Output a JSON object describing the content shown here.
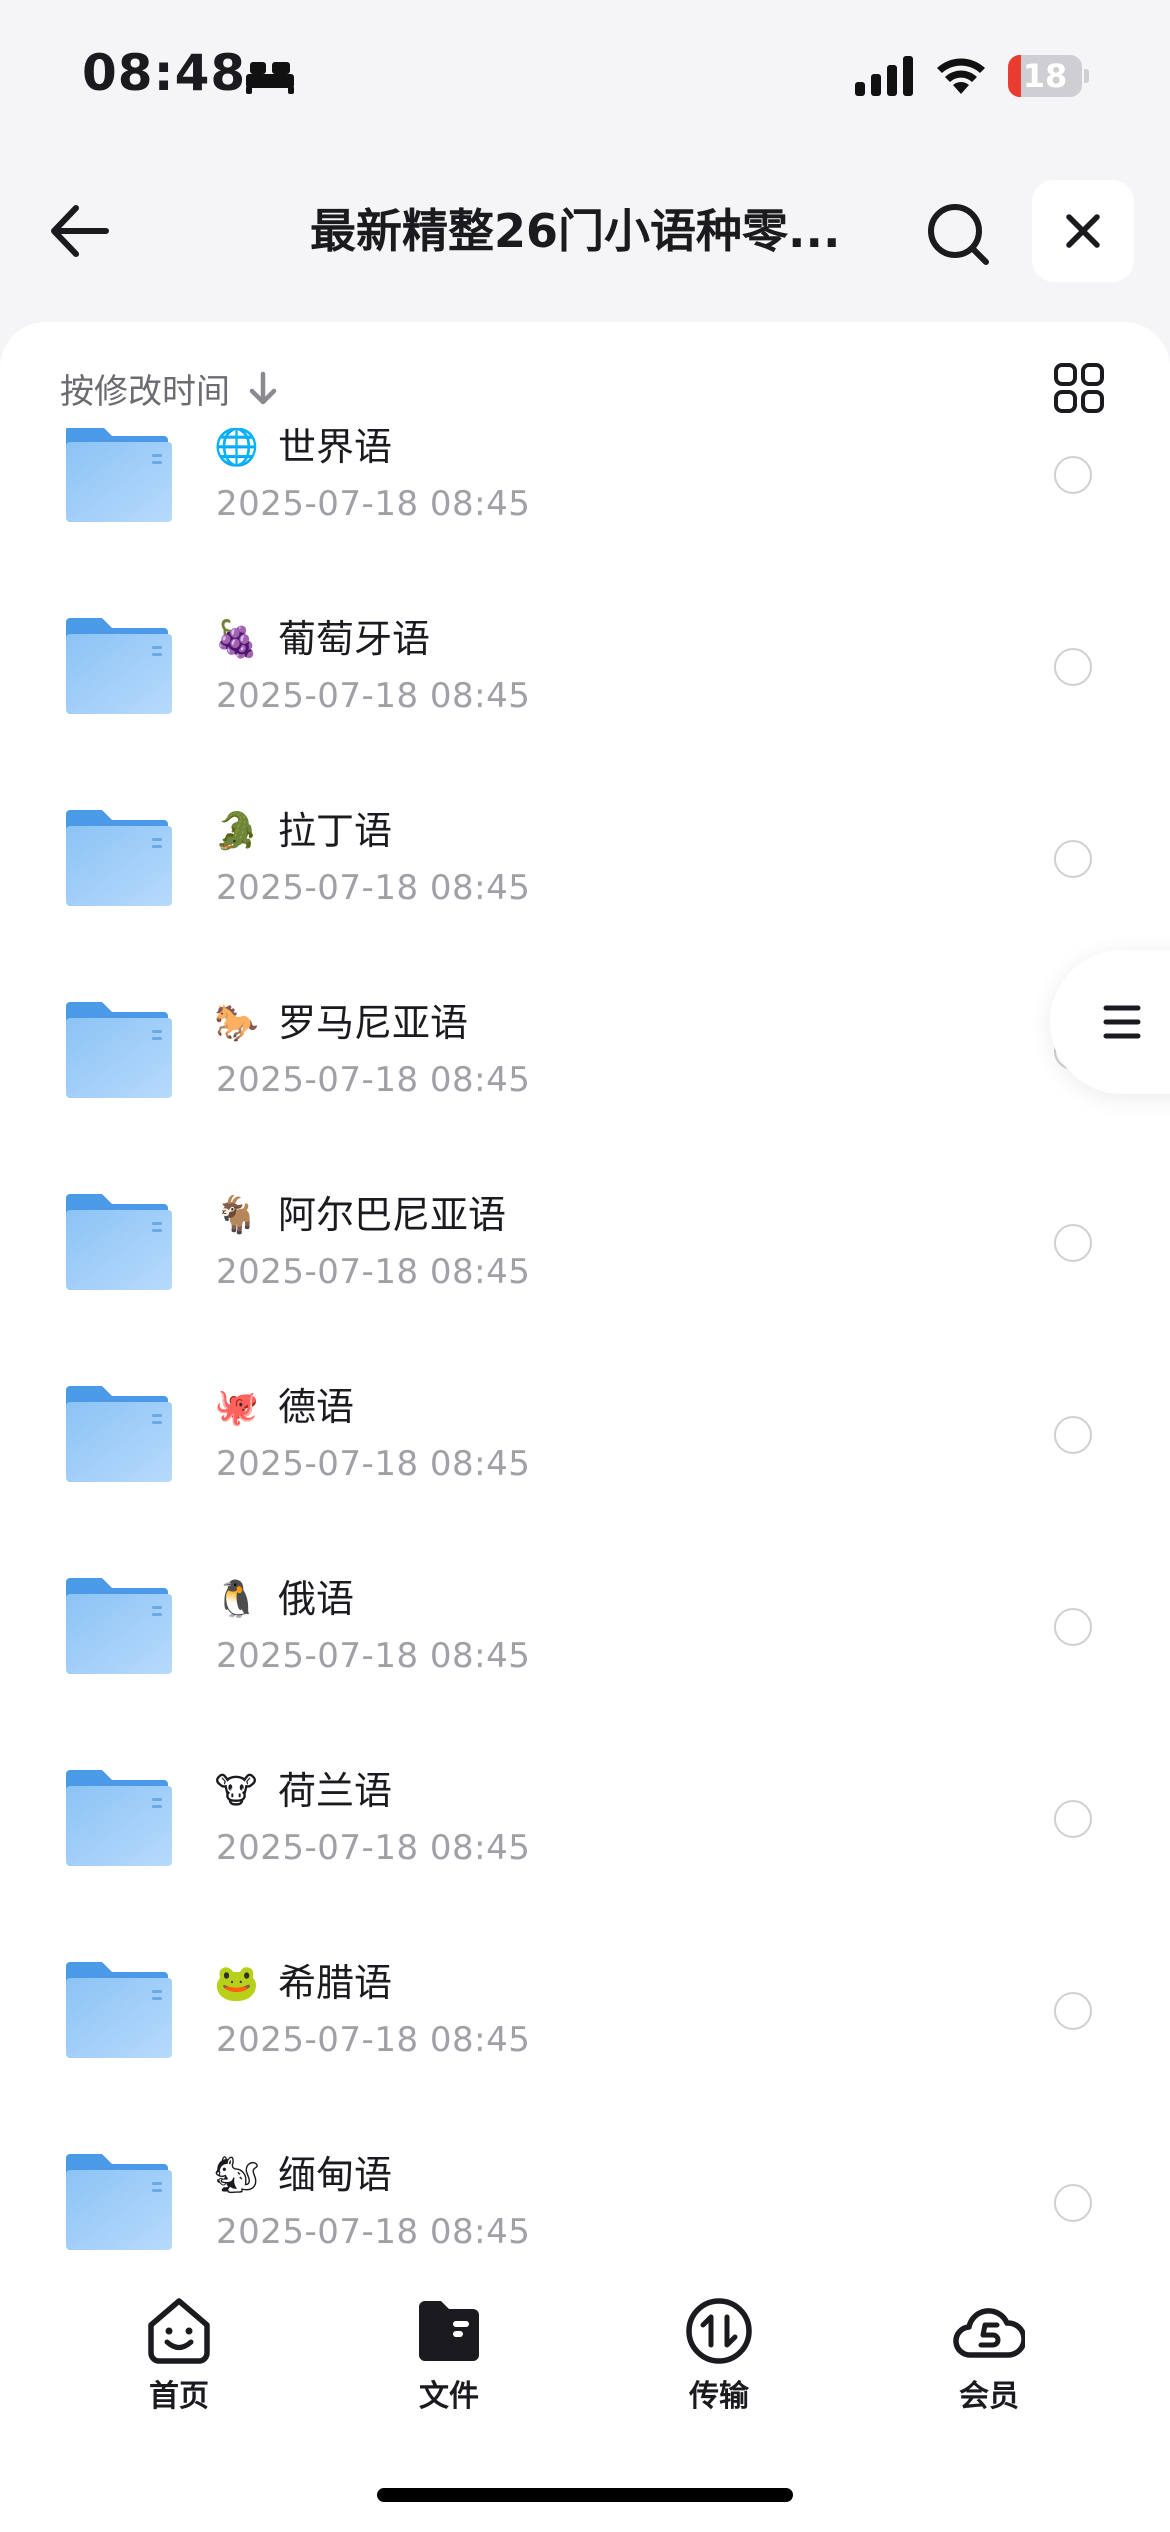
{
  "status_bar": {
    "time": "08:48",
    "battery_level": "18",
    "battery_fraction": 0.18
  },
  "header": {
    "title": "最新精整26门小语种零..."
  },
  "sort": {
    "label": "按修改时间"
  },
  "files": [
    {
      "emoji": "🌐",
      "name": "世界语",
      "date": "2025-07-18 08:45"
    },
    {
      "emoji": "🍇",
      "name": "葡萄牙语",
      "date": "2025-07-18 08:45"
    },
    {
      "emoji": "🐊",
      "name": "拉丁语",
      "date": "2025-07-18 08:45"
    },
    {
      "emoji": "🐎",
      "name": "罗马尼亚语",
      "date": "2025-07-18 08:45"
    },
    {
      "emoji": "🐐",
      "name": "阿尔巴尼亚语",
      "date": "2025-07-18 08:45"
    },
    {
      "emoji": "🐙",
      "name": "德语",
      "date": "2025-07-18 08:45"
    },
    {
      "emoji": "🐧",
      "name": "俄语",
      "date": "2025-07-18 08:45"
    },
    {
      "emoji": "🐮",
      "name": "荷兰语",
      "date": "2025-07-18 08:45"
    },
    {
      "emoji": "🐸",
      "name": "希腊语",
      "date": "2025-07-18 08:45"
    },
    {
      "emoji": "🐿",
      "name": "缅甸语",
      "date": "2025-07-18 08:45"
    }
  ],
  "tabs": [
    {
      "label": "首页",
      "icon": "smiley-home-icon"
    },
    {
      "label": "文件",
      "icon": "folder-files-icon"
    },
    {
      "label": "传输",
      "icon": "transfer-icon"
    },
    {
      "label": "会员",
      "icon": "cloud-vip-icon"
    }
  ],
  "colors": {
    "folder": "#64aef0",
    "accent_red": "#ea3b30",
    "muted_text": "#a0a0a6"
  }
}
